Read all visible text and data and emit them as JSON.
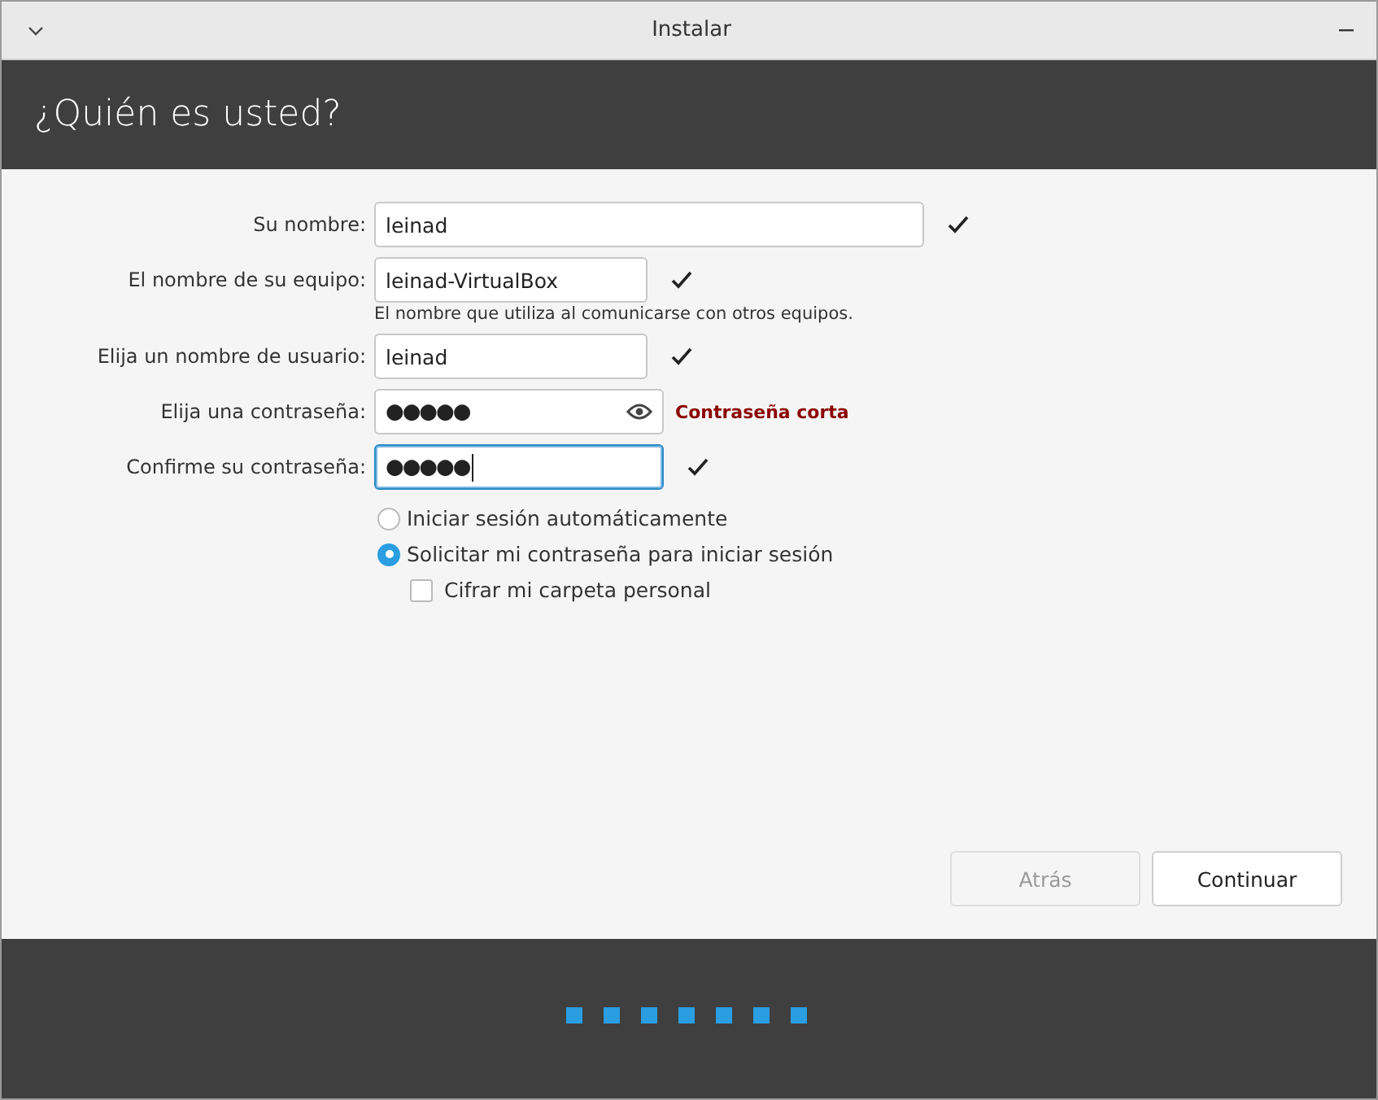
{
  "window": {
    "title": "Instalar"
  },
  "header": {
    "title": "¿Quién es usted?"
  },
  "fields": [
    {
      "label": "Su nombre:",
      "value": "leinad",
      "kind": "text",
      "valid": true,
      "focused": false
    },
    {
      "label": "El nombre de su equipo:",
      "value": "leinad-VirtualBox",
      "kind": "text",
      "valid": true,
      "focused": false,
      "hint": "El nombre que utiliza al comunicarse con otros equipos."
    },
    {
      "label": "Elija un nombre de usuario:",
      "value": "leinad",
      "kind": "text",
      "valid": true,
      "focused": false
    },
    {
      "label": "Elija una contraseña:",
      "value": "●●●●●",
      "kind": "password",
      "valid": false,
      "focused": false,
      "warning": "Contraseña corta"
    },
    {
      "label": "Confirme su contraseña:",
      "value": "●●●●●",
      "kind": "text",
      "valid": true,
      "focused": true
    }
  ],
  "login_options": [
    {
      "label": "Iniciar sesión automáticamente",
      "selected": false
    },
    {
      "label": "Solicitar mi contraseña para iniciar sesión",
      "selected": true
    }
  ],
  "encrypt": {
    "label": "Cifrar mi carpeta personal",
    "checked": false
  },
  "buttons": [
    {
      "label": "Atrás",
      "disabled": true
    },
    {
      "label": "Continuar",
      "disabled": false
    }
  ]
}
